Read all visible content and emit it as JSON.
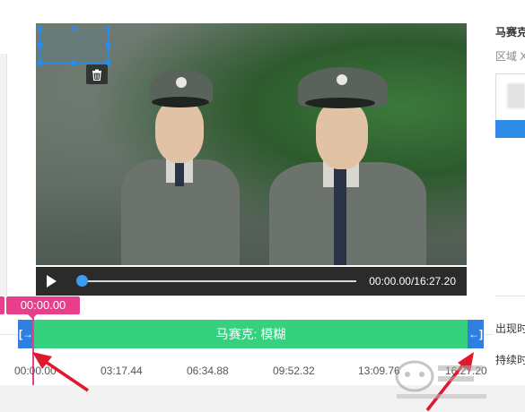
{
  "player": {
    "time_readout": "00:00.00/16:27.20",
    "progress": 0
  },
  "timeline": {
    "playhead_time": "00:00.00",
    "clip_label": "马赛克: 模糊",
    "ticks": [
      "00:00.00",
      "03:17.44",
      "06:34.88",
      "09:52.32",
      "13:09.76",
      "16:27.20"
    ]
  },
  "right_panel": {
    "title": "马赛克",
    "subtitle": "区域 X",
    "label_appear": "出现时",
    "label_duration": "持续时"
  },
  "colors": {
    "clip": "#35d17f",
    "handle": "#2e7fe0",
    "playhead": "#e83e8c",
    "selection": "#2e8be6",
    "annotation_arrow": "#e0182c"
  }
}
